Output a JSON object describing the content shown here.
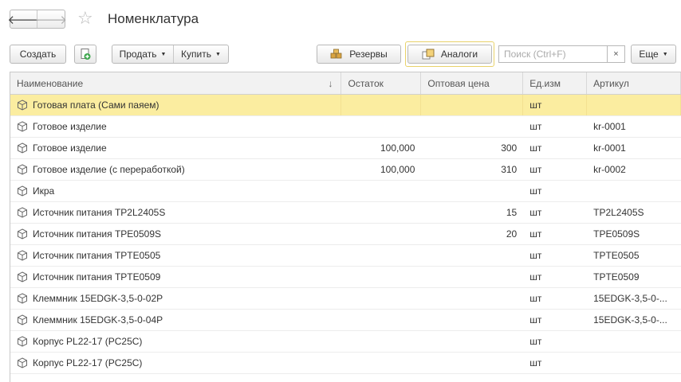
{
  "header": {
    "title": "Номенклатура",
    "back_glyph": "🡐",
    "forward_glyph": "🡒",
    "star_glyph": "☆"
  },
  "toolbar": {
    "create_label": "Создать",
    "sell_label": "Продать",
    "buy_label": "Купить",
    "reserves_label": "Резервы",
    "analogs_label": "Аналоги",
    "search_placeholder": "Поиск (Ctrl+F)",
    "clear_glyph": "×",
    "more_label": "Еще",
    "dropdown_glyph": "▼"
  },
  "table": {
    "columns": {
      "name": "Наименование",
      "stock": "Остаток",
      "price": "Оптовая цена",
      "unit": "Ед.изм",
      "article": "Артикул"
    },
    "sort_glyph": "↓",
    "rows": [
      {
        "name": "Готовая плата (Сами паяем)",
        "stock": "",
        "price": "",
        "unit": "шт",
        "article": ""
      },
      {
        "name": "Готовое изделие",
        "stock": "",
        "price": "",
        "unit": "шт",
        "article": "kr-0001"
      },
      {
        "name": "Готовое изделие",
        "stock": "100,000",
        "price": "300",
        "unit": "шт",
        "article": "kr-0001"
      },
      {
        "name": "Готовое изделие (с переработкой)",
        "stock": "100,000",
        "price": "310",
        "unit": "шт",
        "article": "kr-0002"
      },
      {
        "name": "Икра",
        "stock": "",
        "price": "",
        "unit": "шт",
        "article": ""
      },
      {
        "name": "Источник питания TP2L2405S",
        "stock": "",
        "price": "15",
        "unit": "шт",
        "article": "TP2L2405S"
      },
      {
        "name": "Источник питания TPE0509S",
        "stock": "",
        "price": "20",
        "unit": "шт",
        "article": "TPE0509S"
      },
      {
        "name": "Источник питания TPTE0505",
        "stock": "",
        "price": "",
        "unit": "шт",
        "article": "TPTE0505"
      },
      {
        "name": "Источник питания TPTE0509",
        "stock": "",
        "price": "",
        "unit": "шт",
        "article": "TPTE0509"
      },
      {
        "name": "Клеммник 15EDGK-3,5-0-02P",
        "stock": "",
        "price": "",
        "unit": "шт",
        "article": "15EDGK-3,5-0-..."
      },
      {
        "name": "Клеммник 15EDGK-3,5-0-04P",
        "stock": "",
        "price": "",
        "unit": "шт",
        "article": "15EDGK-3,5-0-..."
      },
      {
        "name": "Корпус PL22-17 (PC25C)",
        "stock": "",
        "price": "",
        "unit": "шт",
        "article": ""
      },
      {
        "name": "Корпус PL22-17 (PC25C)",
        "stock": "",
        "price": "",
        "unit": "шт",
        "article": ""
      }
    ]
  },
  "colors": {
    "selected_row": "#fbeda0",
    "focus_ring": "#e8d26a",
    "add_icon": "#3aa54a"
  },
  "icons": {
    "item": "box-icon",
    "add": "add-copy-icon",
    "reserves": "box-stack-icon",
    "analogs": "analogs-icon"
  }
}
